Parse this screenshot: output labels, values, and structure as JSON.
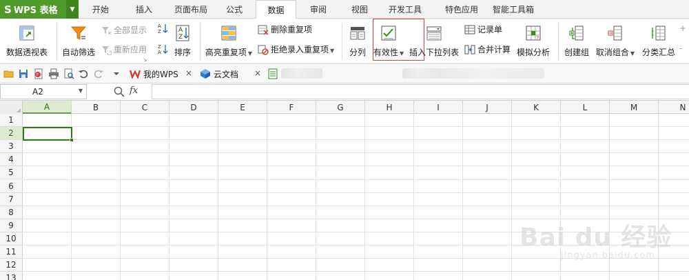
{
  "app": {
    "logo": "S",
    "name": "WPS 表格"
  },
  "menu": {
    "tabs": [
      "开始",
      "插入",
      "页面布局",
      "公式",
      "数据",
      "审阅",
      "视图",
      "开发工具",
      "特色应用",
      "智能工具箱"
    ],
    "active": "数据"
  },
  "ribbon": {
    "pivot": "数据透视表",
    "autofilter": "自动筛选",
    "show_all": "全部显示",
    "reapply": "重新应用",
    "sort": "排序",
    "highlight_dup": "高亮重复项",
    "remove_dup": "删除重复项",
    "reject_dup": "拒绝录入重复项",
    "split": "分列",
    "validity": "有效性",
    "insert_dropdown": "插入下拉列表",
    "record_form": "记录单",
    "consolidate": "合并计算",
    "what_if": "模拟分析",
    "group": "创建组",
    "ungroup": "取消组合",
    "subtotal": "分类汇总",
    "plus_btn": "+",
    "minus_btn": "-",
    "highlight_color": "#e23b3b"
  },
  "doc_tabs": [
    {
      "label": "我的WPS"
    },
    {
      "label": "云文档"
    }
  ],
  "formula_bar": {
    "name_box": "A2",
    "fx_label": "fx",
    "value": ""
  },
  "grid": {
    "columns": [
      "A",
      "B",
      "C",
      "D",
      "E",
      "F",
      "G",
      "H",
      "I",
      "J",
      "K",
      "L",
      "M",
      "N"
    ],
    "rows": [
      "1",
      "2",
      "3",
      "4",
      "5",
      "6",
      "7",
      "8",
      "9",
      "10",
      "11",
      "12",
      "13"
    ],
    "selected_col": "A",
    "selected_row": "2",
    "accent": "#2f7d18"
  },
  "watermark": {
    "main": "Bai du 经验",
    "sub": "jingyan.baidu.com"
  }
}
